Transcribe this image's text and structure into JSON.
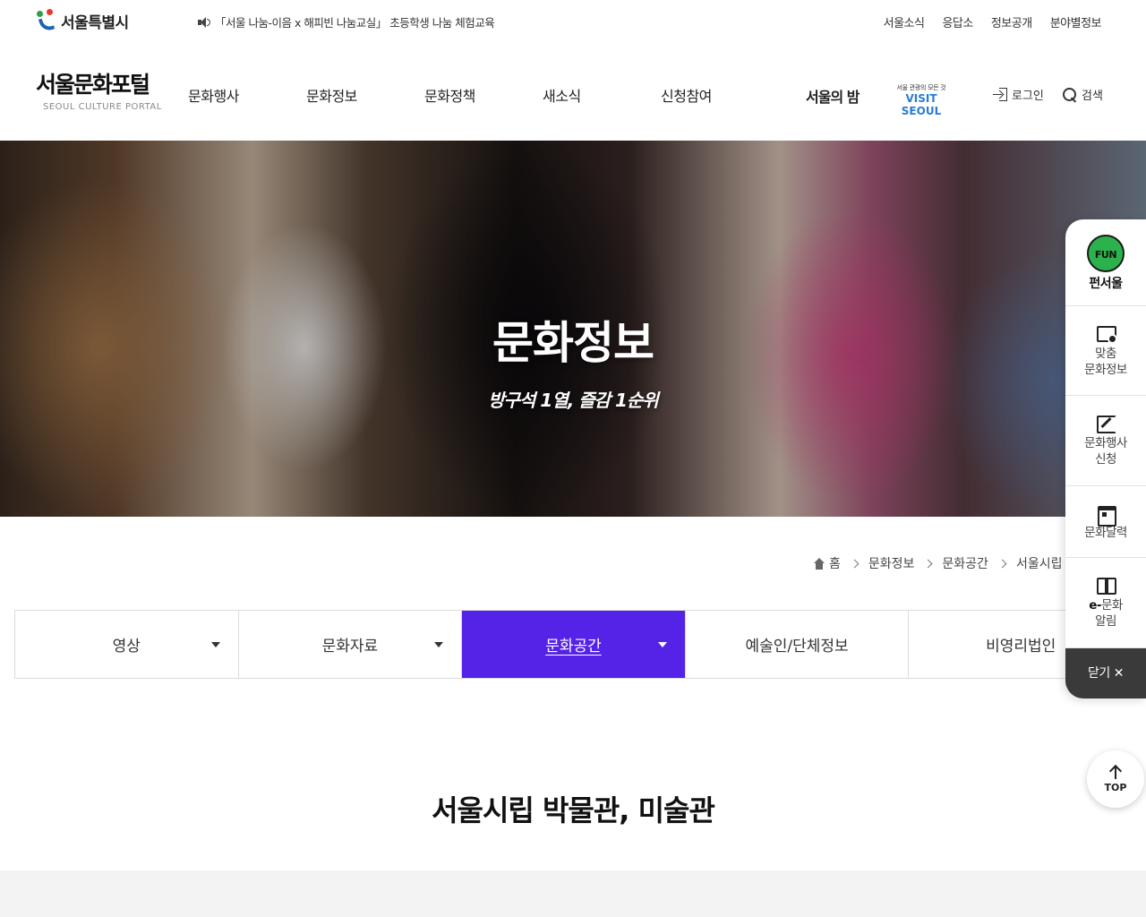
{
  "topbar": {
    "seoul_logo": "서울특별시",
    "notice": "「서울 나눔-이음 x 해피빈 나눔교실」 초등학생 나눔 체험교육",
    "links": [
      "서울소식",
      "응답소",
      "정보공개",
      "분야별정보"
    ]
  },
  "header": {
    "brand_kr": "서울문화포털",
    "brand_en": "SEOUL CULTURE PORTAL",
    "nav": [
      "문화행사",
      "문화정보",
      "문화정책",
      "새소식",
      "신청참여"
    ],
    "night_logo": "서울의 밤",
    "visit_sub": "서울 관광의 모든 것",
    "visit_main": "VISIT SEOUL",
    "login": "로그인",
    "search": "검색"
  },
  "hero": {
    "title": "문화정보",
    "subtitle": "방구석 1열, 즐감 1순위"
  },
  "breadcrumb": [
    "홈",
    "문화정보",
    "문화공간",
    "서울시립 박물관, 미술관"
  ],
  "tabs": [
    {
      "label": "영상",
      "has_dropdown": true,
      "active": false
    },
    {
      "label": "문화자료",
      "has_dropdown": true,
      "active": false
    },
    {
      "label": "문화공간",
      "has_dropdown": true,
      "active": true
    },
    {
      "label": "예술인/단체정보",
      "has_dropdown": false,
      "active": false
    },
    {
      "label": "비영리법인",
      "has_dropdown": false,
      "active": false
    }
  ],
  "section": {
    "title": "서울시립 박물관, 미술관"
  },
  "quick_menu": {
    "fun_label": "펀서울",
    "custom_1": "맞춤",
    "custom_2": "문화정보",
    "apply_1": "문화행사",
    "apply_2": "신청",
    "calendar": "문화달력",
    "ealert_e": "e-",
    "ealert_1": "문화",
    "ealert_2": "알림",
    "close": "닫기"
  },
  "top_button": "TOP",
  "colors": {
    "accent": "#5522e8",
    "quick_close_bg": "#3a3a3a",
    "fun_green": "#2bb24c"
  }
}
